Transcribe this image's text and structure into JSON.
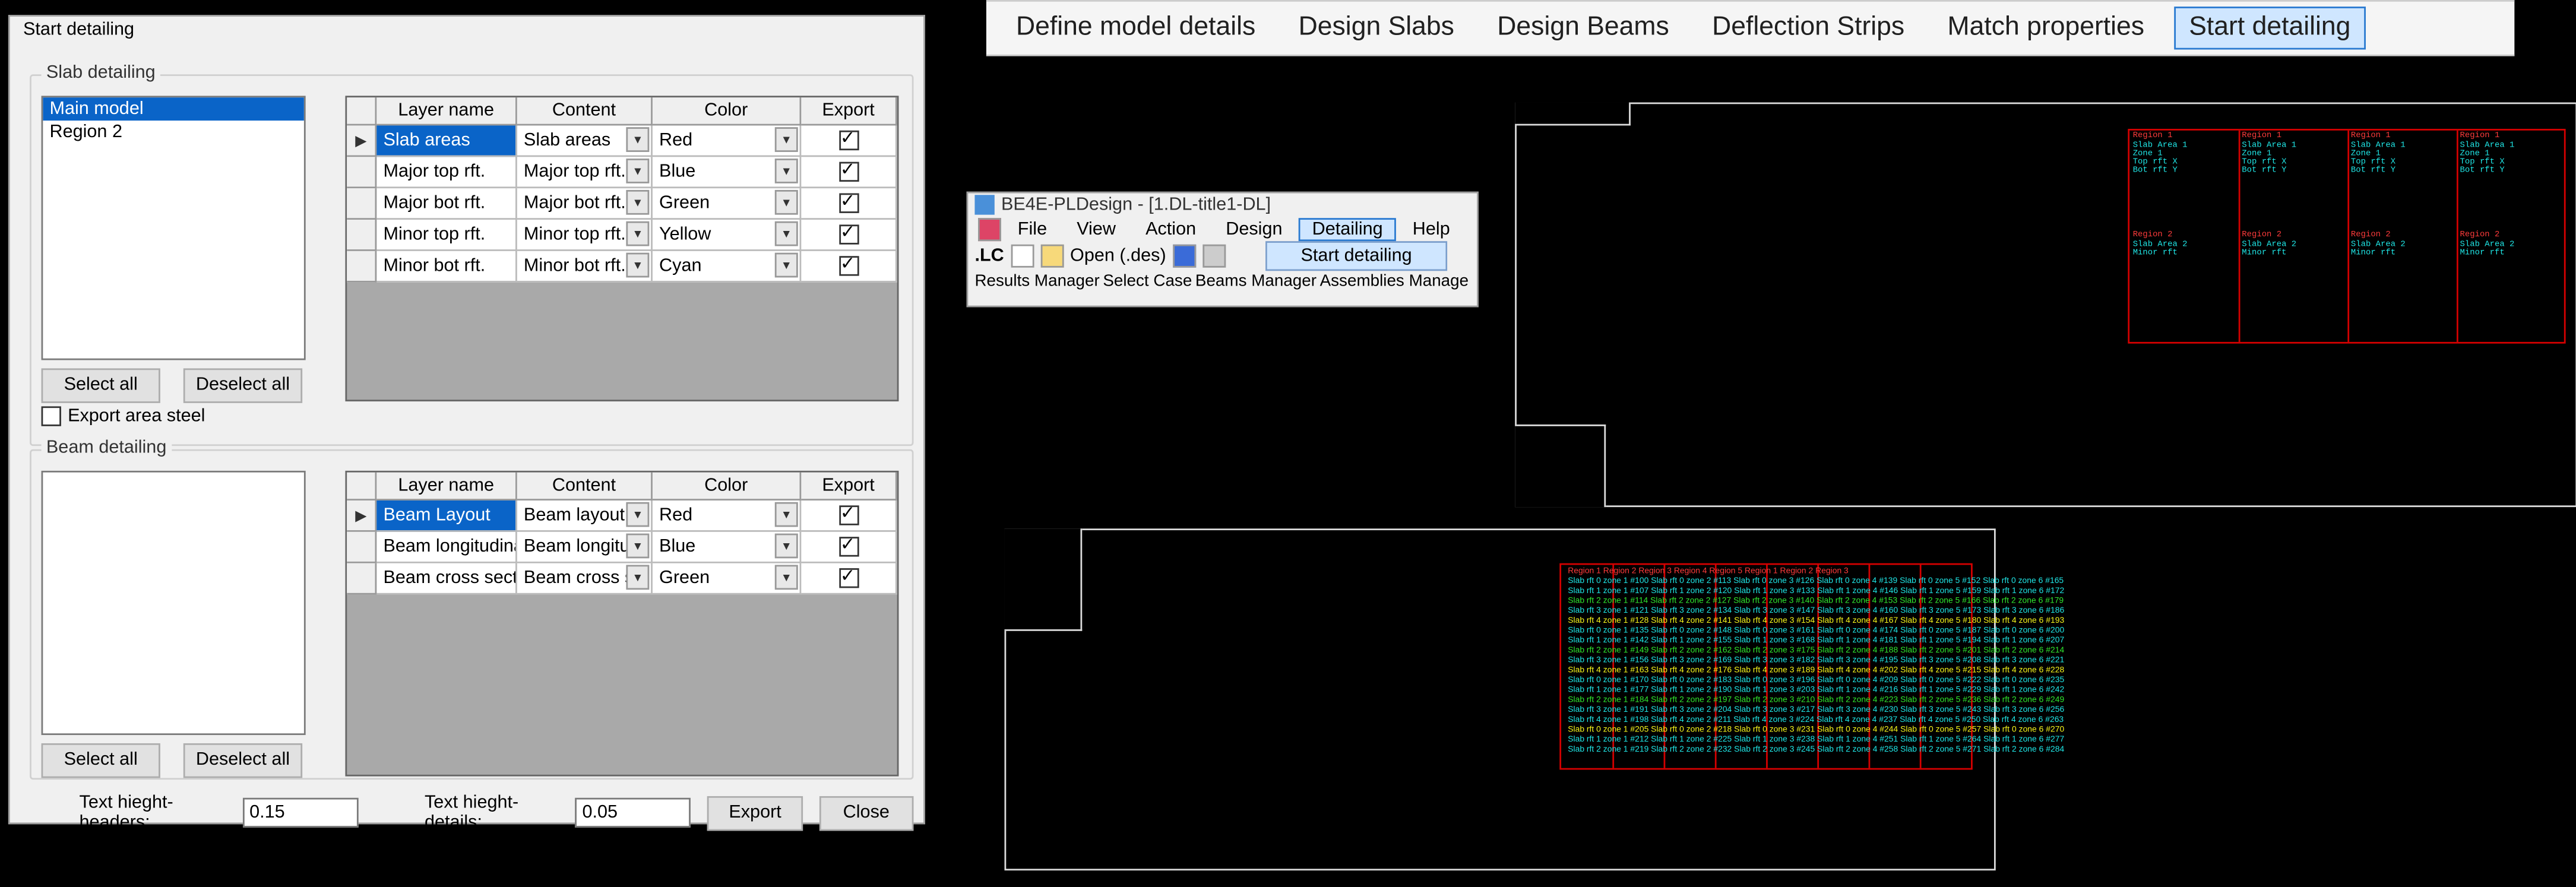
{
  "dialog": {
    "title": "Start detailing",
    "slab": {
      "group_label": "Slab detailing",
      "list": [
        "Main model",
        "Region 2"
      ],
      "select_all": "Select all",
      "deselect_all": "Deselect all",
      "export_area_steel": "Export area steel",
      "headers": {
        "layer": "Layer name",
        "content": "Content",
        "color": "Color",
        "export": "Export"
      },
      "rows": [
        {
          "layer": "Slab areas",
          "content": "Slab areas",
          "color": "Red",
          "export": true,
          "selected": true
        },
        {
          "layer": "Major top rft.",
          "content": "Major top rft.",
          "color": "Blue",
          "export": true
        },
        {
          "layer": "Major bot rft.",
          "content": "Major bot rft.",
          "color": "Green",
          "export": true
        },
        {
          "layer": "Minor top rft.",
          "content": "Minor top rft.",
          "color": "Yellow",
          "export": true
        },
        {
          "layer": "Minor bot rft.",
          "content": "Minor bot rft.",
          "color": "Cyan",
          "export": true
        }
      ]
    },
    "beam": {
      "group_label": "Beam detailing",
      "select_all": "Select all",
      "deselect_all": "Deselect all",
      "headers": {
        "layer": "Layer name",
        "content": "Content",
        "color": "Color",
        "export": "Export"
      },
      "rows": [
        {
          "layer": "Beam Layout",
          "content": "Beam layout",
          "color": "Red",
          "export": true,
          "selected": true
        },
        {
          "layer": "Beam longitudinal...",
          "content": "Beam longitu...",
          "color": "Blue",
          "export": true
        },
        {
          "layer": "Beam cross secti...",
          "content": "Beam cross s...",
          "color": "Green",
          "export": true
        }
      ]
    },
    "footer": {
      "text_height_headers_label": "Text hieght-headers:",
      "text_height_headers_value": "0.15",
      "text_height_details_label": "Text hieght-details:",
      "text_height_details_value": "0.05",
      "export": "Export",
      "close": "Close"
    }
  },
  "main_toolbar": {
    "items": [
      "Define model details",
      "Design Slabs",
      "Design Beams",
      "Deflection Strips",
      "Match properties",
      "Start detailing"
    ],
    "active_index": 5
  },
  "mini": {
    "title": "BE4E-PLDesign - [1.DL-title1-DL]",
    "menus": [
      "File",
      "View",
      "Action",
      "Design",
      "Detailing",
      "Help"
    ],
    "active_menu_index": 4,
    "lc_label": ".LC",
    "open_label": "Open (.des)",
    "dropdown_item": "Start detailing",
    "bottom": [
      "Results Manager",
      "Select Case",
      "Beams Manager",
      "Assemblies Manage"
    ]
  },
  "cad": {
    "top": {
      "cells": [
        {
          "hdr": "Region 1",
          "lines": [
            "Slab Area 1",
            "Zone 1",
            "Top rft X",
            "Bot rft Y"
          ],
          "hdr2": "Region 2",
          "lines2": [
            "Slab Area 2",
            "Minor rft"
          ]
        },
        {
          "hdr": "Region 1",
          "lines": [
            "Slab Area 1",
            "Zone 1",
            "Top rft X",
            "Bot rft Y"
          ],
          "hdr2": "Region 2",
          "lines2": [
            "Slab Area 2",
            "Minor rft"
          ]
        },
        {
          "hdr": "Region 1",
          "lines": [
            "Slab Area 1",
            "Zone 1",
            "Top rft X",
            "Bot rft Y"
          ],
          "hdr2": "Region 2",
          "lines2": [
            "Slab Area 2",
            "Minor rft"
          ]
        },
        {
          "hdr": "Region 1",
          "lines": [
            "Slab Area 1",
            "Zone 1",
            "Top rft X",
            "Bot rft Y"
          ],
          "hdr2": "Region 2",
          "lines2": [
            "Slab Area 2",
            "Minor rft"
          ]
        }
      ]
    },
    "bot": {
      "headers": [
        "Region 1",
        "Region 2",
        "Region 3",
        "Region 4",
        "Region 5",
        "Region 1",
        "Region 2",
        "Region 3"
      ]
    }
  }
}
